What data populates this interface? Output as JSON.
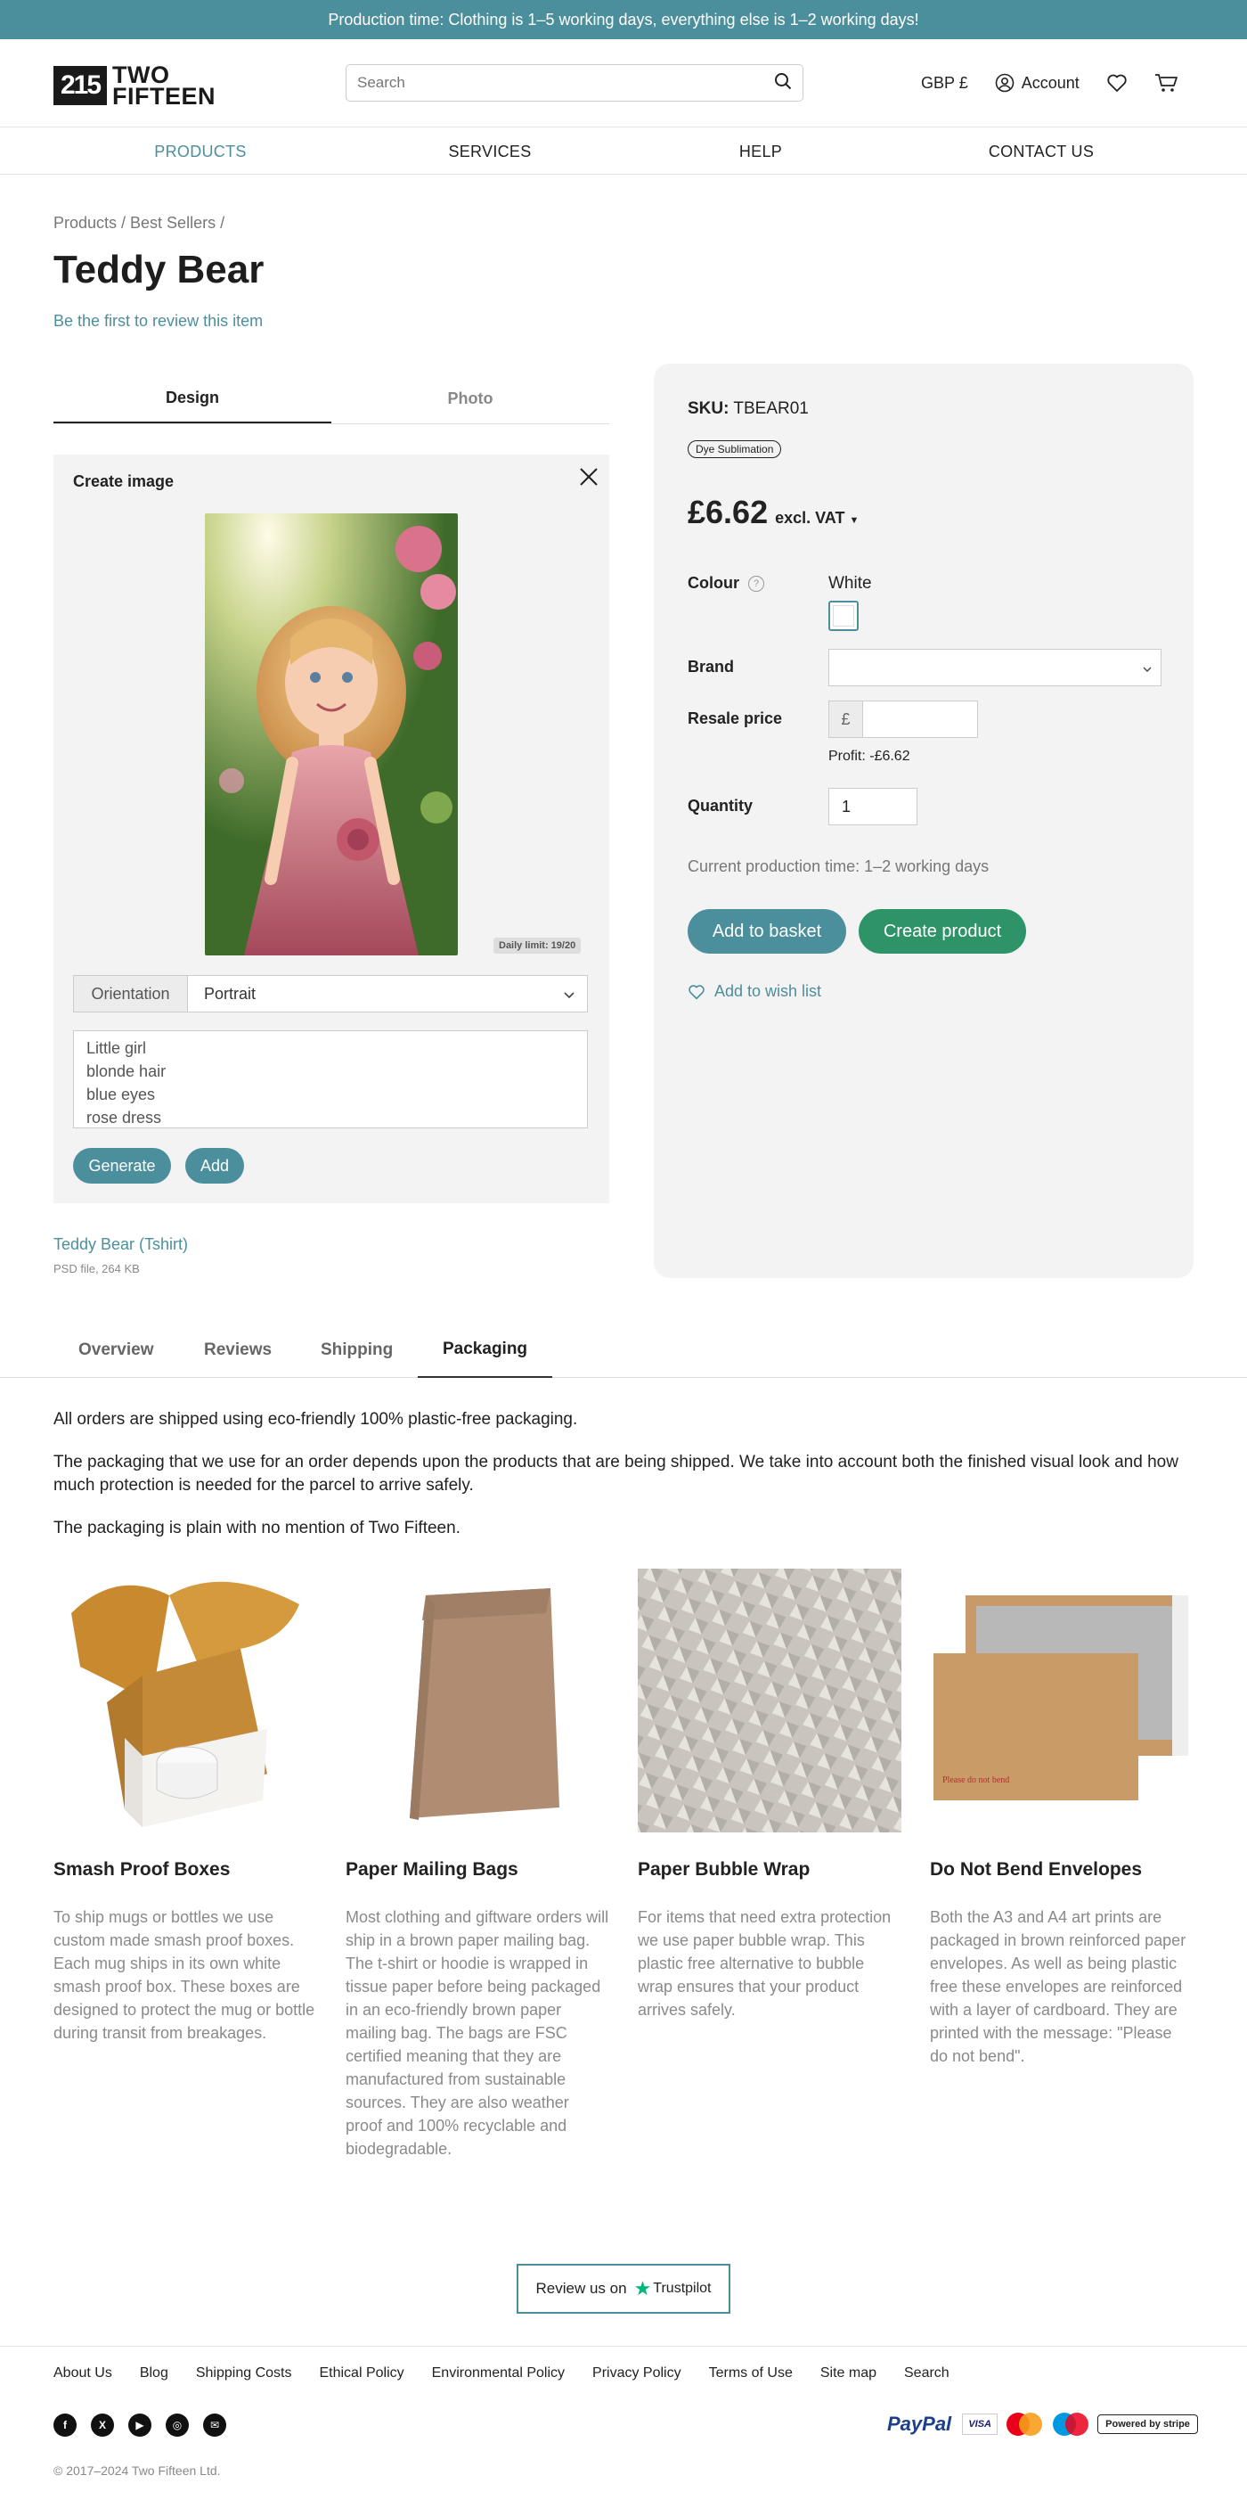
{
  "banner": "Production time: Clothing is 1–5 working days, everything else is 1–2 working days!",
  "logo": {
    "mark": "215",
    "line1": "TWO",
    "line2": "FIFTEEN"
  },
  "search": {
    "placeholder": "Search"
  },
  "header": {
    "currency": "GBP £",
    "account": "Account"
  },
  "nav": [
    "PRODUCTS",
    "SERVICES",
    "HELP",
    "CONTACT US"
  ],
  "breadcrumb": "Products / Best Sellers /",
  "product": {
    "title": "Teddy Bear",
    "review_link": "Be the first to review this item",
    "tabs": [
      "Design",
      "Photo"
    ],
    "create": {
      "title": "Create image",
      "daily_limit": "Daily limit: 19/20",
      "orientation_label": "Orientation",
      "orientation_value": "Portrait",
      "prompt_lines": [
        "Little girl",
        "blonde hair",
        "blue eyes",
        "rose dress"
      ],
      "generate": "Generate",
      "add": "Add"
    },
    "file": {
      "name": "Teddy Bear (Tshirt)",
      "meta": "PSD file, 264 KB"
    },
    "sku_label": "SKU:",
    "sku": "TBEAR01",
    "badge": "Dye Sublimation",
    "price": "£6.62",
    "vat": "excl. VAT",
    "colour_label": "Colour",
    "colour_value": "White",
    "brand_label": "Brand",
    "resale_label": "Resale price",
    "currency_symbol": "£",
    "profit": "Profit: -£6.62",
    "quantity_label": "Quantity",
    "quantity": "1",
    "production_time": "Current production time: 1–2 working days",
    "add_to_basket": "Add to basket",
    "create_product": "Create product",
    "wish_list": "Add to wish list"
  },
  "info_tabs": [
    "Overview",
    "Reviews",
    "Shipping",
    "Packaging"
  ],
  "packaging": {
    "paragraphs": [
      "All orders are shipped using eco-friendly 100% plastic-free packaging.",
      "The packaging that we use for an order depends upon the products that are being shipped. We take into account both the finished visual look and how much protection is needed for the parcel to arrive safely.",
      "The packaging is plain with no mention of Two Fifteen."
    ],
    "items": [
      {
        "title": "Smash Proof Boxes",
        "desc": "To ship mugs or bottles we use custom made smash proof boxes. Each mug ships in its own white smash proof box. These boxes are designed to protect the mug or bottle during transit from breakages."
      },
      {
        "title": "Paper Mailing Bags",
        "desc": "Most clothing and giftware orders will ship in a brown paper mailing bag. The t-shirt or hoodie is wrapped in tissue paper before being packaged in an eco-friendly brown paper mailing bag. The bags are FSC certified meaning that they are manufactured from sustainable sources. They are also weather proof and 100% recyclable and biodegradable."
      },
      {
        "title": "Paper Bubble Wrap",
        "desc": "For items that need extra protection we use paper bubble wrap. This plastic free alternative to bubble wrap ensures that your product arrives safely."
      },
      {
        "title": "Do Not Bend Envelopes",
        "desc": "Both the A3 and A4 art prints are packaged in brown reinforced paper envelopes. As well as being plastic free these envelopes are reinforced with a layer of cardboard. They are printed with the message: \"Please do not bend\"."
      }
    ],
    "envelope_text": "Please do not bend"
  },
  "trustpilot": {
    "prefix": "Review us on",
    "brand": "Trustpilot"
  },
  "footer": {
    "links": [
      "About Us",
      "Blog",
      "Shipping Costs",
      "Ethical Policy",
      "Environmental Policy",
      "Privacy Policy",
      "Terms of Use",
      "Site map",
      "Search"
    ],
    "social_icons": [
      "facebook-icon",
      "x-icon",
      "youtube-icon",
      "instagram-icon",
      "email-icon"
    ],
    "payments": {
      "paypal": "PayPal",
      "visa": "VISA",
      "stripe": "Powered by stripe"
    },
    "copyright": "© 2017–2024 Two Fifteen Ltd."
  },
  "colors": {
    "accent": "#4c8f9c",
    "green": "#2e9468"
  }
}
